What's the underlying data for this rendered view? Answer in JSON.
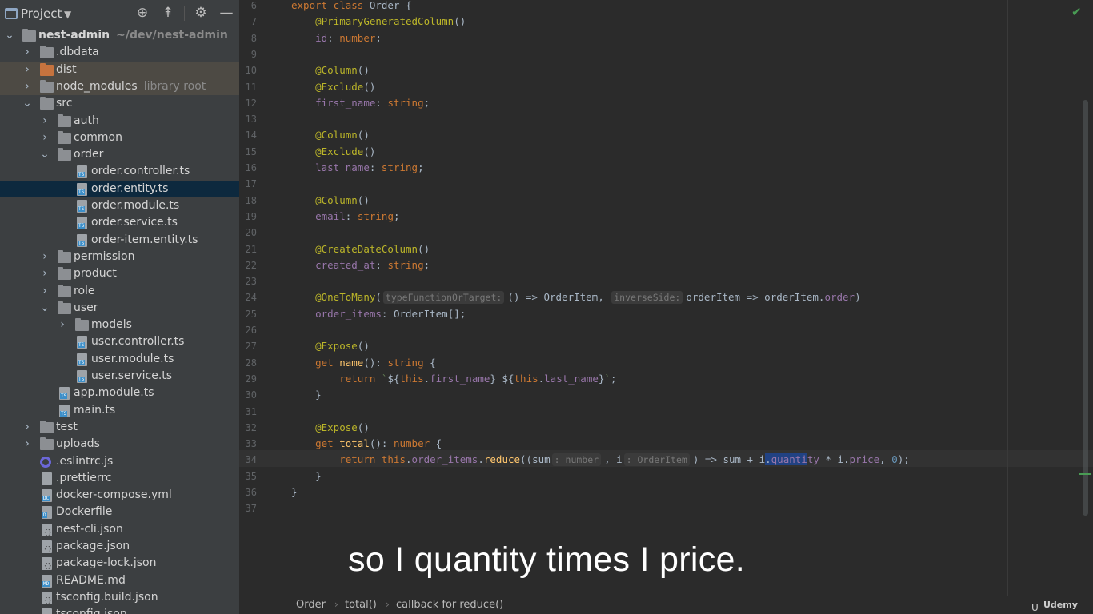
{
  "panel": {
    "title": "Project",
    "dropdown": "▼",
    "icons": [
      "crosshair-icon",
      "collapse-icon",
      "gear-icon",
      "minimize-icon"
    ]
  },
  "tree": [
    {
      "label": "nest-admin",
      "hint": "~/dev/nest-admin",
      "kind": "folder",
      "depth": 0,
      "chev": "⌄",
      "bold": true
    },
    {
      "label": ".dbdata",
      "kind": "folder",
      "depth": 1,
      "chev": "›"
    },
    {
      "label": "dist",
      "kind": "folder-orange",
      "depth": 1,
      "chev": "›",
      "hl": true
    },
    {
      "label": "node_modules",
      "hint": "library root",
      "kind": "folder",
      "depth": 1,
      "chev": "›",
      "hl": true
    },
    {
      "label": "src",
      "kind": "folder",
      "depth": 1,
      "chev": "⌄"
    },
    {
      "label": "auth",
      "kind": "folder",
      "depth": 2,
      "chev": "›"
    },
    {
      "label": "common",
      "kind": "folder",
      "depth": 2,
      "chev": "›"
    },
    {
      "label": "order",
      "kind": "folder",
      "depth": 2,
      "chev": "⌄"
    },
    {
      "label": "order.controller.ts",
      "kind": "ts",
      "depth": 3
    },
    {
      "label": "order.entity.ts",
      "kind": "ts",
      "depth": 3,
      "sel": true
    },
    {
      "label": "order.module.ts",
      "kind": "ts",
      "depth": 3
    },
    {
      "label": "order.service.ts",
      "kind": "ts",
      "depth": 3
    },
    {
      "label": "order-item.entity.ts",
      "kind": "ts",
      "depth": 3
    },
    {
      "label": "permission",
      "kind": "folder",
      "depth": 2,
      "chev": "›"
    },
    {
      "label": "product",
      "kind": "folder",
      "depth": 2,
      "chev": "›"
    },
    {
      "label": "role",
      "kind": "folder",
      "depth": 2,
      "chev": "›"
    },
    {
      "label": "user",
      "kind": "folder",
      "depth": 2,
      "chev": "⌄"
    },
    {
      "label": "models",
      "kind": "folder",
      "depth": 3,
      "chev": "›"
    },
    {
      "label": "user.controller.ts",
      "kind": "ts",
      "depth": 3
    },
    {
      "label": "user.module.ts",
      "kind": "ts",
      "depth": 3
    },
    {
      "label": "user.service.ts",
      "kind": "ts",
      "depth": 3
    },
    {
      "label": "app.module.ts",
      "kind": "ts",
      "depth": 2
    },
    {
      "label": "main.ts",
      "kind": "ts",
      "depth": 2
    },
    {
      "label": "test",
      "kind": "folder",
      "depth": 1,
      "chev": "›"
    },
    {
      "label": "uploads",
      "kind": "folder",
      "depth": 1,
      "chev": "›"
    },
    {
      "label": ".eslintrc.js",
      "kind": "eslint",
      "depth": 1
    },
    {
      "label": ".prettierrc",
      "kind": "plain",
      "depth": 1
    },
    {
      "label": "docker-compose.yml",
      "kind": "dc",
      "depth": 1
    },
    {
      "label": "Dockerfile",
      "kind": "docker",
      "depth": 1
    },
    {
      "label": "nest-cli.json",
      "kind": "json",
      "depth": 1
    },
    {
      "label": "package.json",
      "kind": "json",
      "depth": 1
    },
    {
      "label": "package-lock.json",
      "kind": "json",
      "depth": 1
    },
    {
      "label": "README.md",
      "kind": "md",
      "depth": 1
    },
    {
      "label": "tsconfig.build.json",
      "kind": "json",
      "depth": 1
    },
    {
      "label": "tsconfig.json",
      "kind": "json",
      "depth": 1
    }
  ],
  "editor": {
    "lines": [
      {
        "n": "6",
        "html": "<span class=\"kw\">export class </span>Order {"
      },
      {
        "n": "7",
        "html": "    <span class=\"an\">@PrimaryGeneratedColumn</span>()"
      },
      {
        "n": "8",
        "html": "    <span class=\"fld\">id</span>: <span class=\"kw\">number</span>;"
      },
      {
        "n": "9",
        "html": ""
      },
      {
        "n": "10",
        "html": "    <span class=\"an\">@Column</span>()"
      },
      {
        "n": "11",
        "html": "    <span class=\"an\">@Exclude</span>()"
      },
      {
        "n": "12",
        "html": "    <span class=\"fld\">first_name</span>: <span class=\"kw\">string</span>;"
      },
      {
        "n": "13",
        "html": ""
      },
      {
        "n": "14",
        "html": "    <span class=\"an\">@Column</span>()"
      },
      {
        "n": "15",
        "html": "    <span class=\"an\">@Exclude</span>()"
      },
      {
        "n": "16",
        "html": "    <span class=\"fld\">last_name</span>: <span class=\"kw\">string</span>;"
      },
      {
        "n": "17",
        "html": ""
      },
      {
        "n": "18",
        "html": "    <span class=\"an\">@Column</span>()"
      },
      {
        "n": "19",
        "html": "    <span class=\"fld\">email</span>: <span class=\"kw\">string</span>;"
      },
      {
        "n": "20",
        "html": ""
      },
      {
        "n": "21",
        "html": "    <span class=\"an\">@CreateDateColumn</span>()"
      },
      {
        "n": "22",
        "html": "    <span class=\"fld\">created_at</span>: <span class=\"kw\">string</span>;"
      },
      {
        "n": "23",
        "html": ""
      },
      {
        "n": "24",
        "html": "    <span class=\"an\">@OneToMany</span>(<span class=\"hint\">typeFunctionOrTarget:</span>() => OrderItem, <span class=\"hint\">inverseSide:</span>orderItem => orderItem.<span class=\"fld\">order</span>)"
      },
      {
        "n": "25",
        "html": "    <span class=\"fld\">order_items</span>: OrderItem[];"
      },
      {
        "n": "26",
        "html": ""
      },
      {
        "n": "27",
        "html": "    <span class=\"an\">@Expose</span>()"
      },
      {
        "n": "28",
        "html": "    <span class=\"kw\">get </span><span class=\"fn\">name</span>(): <span class=\"kw\">string </span>{"
      },
      {
        "n": "29",
        "html": "        <span class=\"kw\">return </span><span class=\"str\">`</span>${<span class=\"kw\">this</span>.<span class=\"fld\">first_name</span>} ${<span class=\"kw\">this</span>.<span class=\"fld\">last_name</span>}<span class=\"str\">`</span>;"
      },
      {
        "n": "30",
        "html": "    }"
      },
      {
        "n": "31",
        "html": ""
      },
      {
        "n": "32",
        "html": "    <span class=\"an\">@Expose</span>()"
      },
      {
        "n": "33",
        "html": "    <span class=\"kw\">get </span><span class=\"fn\">total</span>(): <span class=\"kw\">number </span>{"
      },
      {
        "n": "34",
        "html": "        <span class=\"kw\">return this</span>.<span class=\"fld\">order_items</span>.<span class=\"fn\">reduce</span>((sum<span class=\"hint\">: number</span>, i<span class=\"hint\">: OrderItem</span>) => sum + i<span class=\"selword\">.<span class=\"fld\">quanti</span></span><span class=\"fld\">ty</span> * i.<span class=\"fld\">price</span>, <span class=\"num\">0</span>);"
      },
      {
        "n": "35",
        "html": "    }"
      },
      {
        "n": "36",
        "html": "}"
      },
      {
        "n": "37",
        "html": ""
      }
    ]
  },
  "caption": "so I quantity times I price.",
  "breadcrumb": {
    "items": [
      "Order",
      "total()",
      "callback for reduce()"
    ],
    "sep": "›"
  },
  "watermark": {
    "icon": "udemy-logo-icon",
    "text": "Udemy"
  },
  "colors": {
    "panel_bg": "#3c3f41",
    "editor_bg": "#2b2b2b",
    "selection": "#0d293e",
    "keyword": "#cc7832",
    "annotation": "#bbb529",
    "field": "#9876aa",
    "function": "#ffc66d"
  }
}
